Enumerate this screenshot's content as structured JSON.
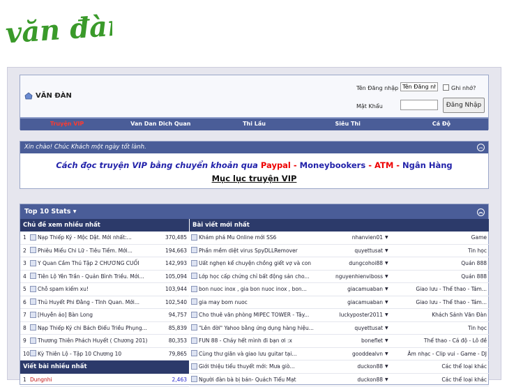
{
  "logo": {
    "text": "văn đàn",
    "color": "#3a9a2a"
  },
  "header": {
    "site_title": "VĂN ĐÀN",
    "login": {
      "username_label": "Tên Đăng nhập",
      "username_value": "Tên Đăng nh",
      "password_label": "Mật Khẩu",
      "remember_label": "Ghi nhớ?",
      "login_button": "Đăng Nhập"
    },
    "nav": [
      "Truyện VIP",
      "Van Dan Dich Quan",
      "Thi Lầu",
      "Siêu Thi",
      "Cá Độ"
    ]
  },
  "notice": {
    "greeting": "Xin chào! Chúc Khách một ngày tốt lành.",
    "line1_text": "Cách đọc truyện VIP bằng chuyển khoản qua",
    "paypal": "Paypal",
    "sep1": " - ",
    "moneybookers": "Moneybookers",
    "sep2": " - ",
    "atm": "ATM",
    "sep3": " - ",
    "bank": "Ngân Hàng",
    "line2": "Mục lục truyện VIP"
  },
  "stats": {
    "title": "Top 10 Stats",
    "most_viewed_header": "Chủ đề xem nhiều nhất",
    "latest_header": "Bài viết mới nhất",
    "most_posts_header": "Viết bài nhiều nhất",
    "most_viewed": [
      {
        "n": "1",
        "title": "Nạp Thiếp Ký - Mộc Dật. Mới nhất:...",
        "views": "370,485"
      },
      {
        "n": "2",
        "title": "Phiêu Miểu Chi Lữ - Tiêu Tiềm. Mới...",
        "views": "194,663"
      },
      {
        "n": "3",
        "title": "Y Quan Cầm Thú Tập 2 CHƯƠNG CUỐI",
        "views": "142,993"
      },
      {
        "n": "4",
        "title": "Tiên Lộ Yên Trần - Quản Bình Triều. Mới...",
        "views": "105,094"
      },
      {
        "n": "5",
        "title": "Chỗ spam kiếm xu!",
        "views": "103,944"
      },
      {
        "n": "6",
        "title": "Thủ Huyết Phi Đằng - Tĩnh Quan. Mới...",
        "views": "102,540"
      },
      {
        "n": "7",
        "title": "[Huyễn ảo] Bàn Long",
        "views": "94,757"
      },
      {
        "n": "8",
        "title": "Nạp Thiếp Ký chi Bách Điểu Triều Phụng...",
        "views": "85,839"
      },
      {
        "n": "9",
        "title": "Thương Thiên Phách Huyết ( Chương 201)",
        "views": "80,353"
      },
      {
        "n": "10",
        "title": "Kỳ Thiên Lộ - Tập 10 Chương 10",
        "views": "79,865"
      }
    ],
    "most_posts": [
      {
        "n": "1",
        "title": "Dungnhi",
        "views": "2,463"
      }
    ],
    "latest": [
      {
        "title": "Khám phá Mu Online mới SS6",
        "user": "nhanvien01",
        "forum": "Game"
      },
      {
        "title": "Phần mềm diệt virus SpyDLLRemover",
        "user": "quyettusat",
        "forum": "Tin học"
      },
      {
        "title": "Uất nghẹn kể chuyện chồng giết vợ và con",
        "user": "dungcohoi88",
        "forum": "Quán 888"
      },
      {
        "title": "Lớp học cấp chứng chỉ bất động sản cho...",
        "user": "nguyenhienviboss",
        "forum": "Quán 888"
      },
      {
        "title": "bon nuoc inox , gia bon nuoc inox , bon...",
        "user": "giacamuaban",
        "forum": "Giao lưu - Thể thao - Tám..."
      },
      {
        "title": "gia may bom nuoc",
        "user": "giacamuaban",
        "forum": "Giao lưu - Thể thao - Tám..."
      },
      {
        "title": "Cho thuê văn phòng MIPEC TOWER - Tây...",
        "user": "luckyposter2011",
        "forum": "Khách Sảnh Văn Đàn"
      },
      {
        "title": "\"Lên đời\" Yahoo bằng ứng dụng hàng hiệu...",
        "user": "quyettusat",
        "forum": "Tin học"
      },
      {
        "title": "FUN 88 - Cháy hết mình đi bạn ơi :x",
        "user": "boneflet",
        "forum": "Thể thao - Cá độ - Lô đề"
      },
      {
        "title": "Cùng thư giãn và giao lưu guitar tại...",
        "user": "gooddealvn",
        "forum": "Âm nhạc - Clip vui - Game - DJ"
      },
      {
        "title": "Giới thiệu tiểu thuyết mới: Mưa giò...",
        "user": "duckon88",
        "forum": "Các thể loại khác"
      },
      {
        "title": "Người đàn bà bị bán- Quách Tiểu Mạt",
        "user": "duckon88",
        "forum": "Các thể loại khác"
      }
    ]
  }
}
